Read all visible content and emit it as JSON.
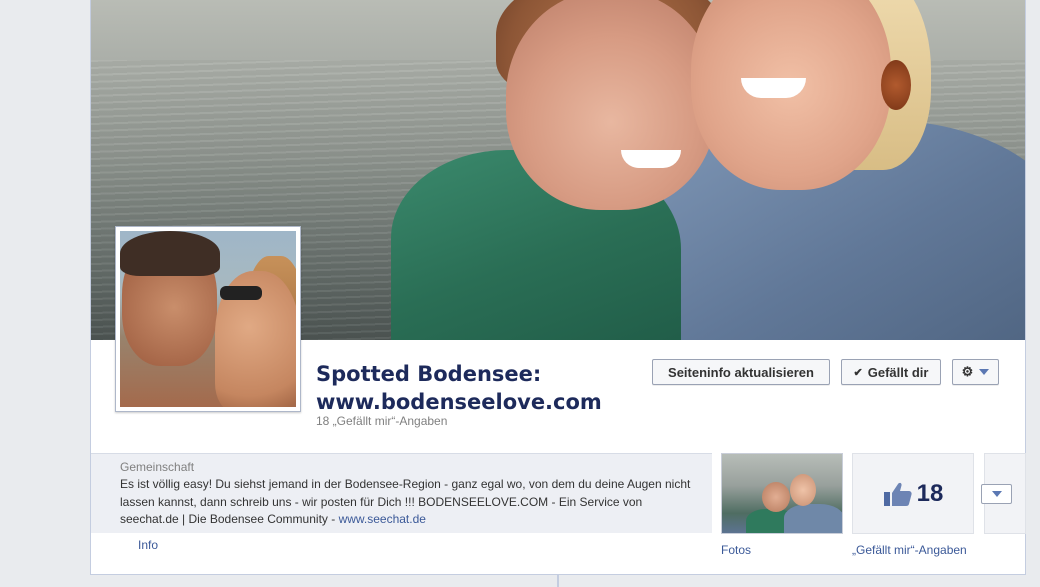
{
  "page": {
    "title_line1": "Spotted Bodensee:",
    "title_line2": "www.bodenseelove.com",
    "likes_line": "18 „Gefällt mir“-Angaben"
  },
  "actions": {
    "update_info_label": "Seiteninfo aktualisieren",
    "liked_label": "Gefällt dir",
    "liked_icon": "checkmark-icon",
    "settings_icon": "gear-icon"
  },
  "about": {
    "category": "Gemeinschaft",
    "description": "Es ist völlig easy! Du siehst jemand in der Bodensee-Region - ganz egal wo, von dem du deine Augen nicht lassen kannst, dann schreib uns - wir posten für Dich !!! BODENSEELOVE.COM - Ein Service von seechat.de | Die Bodensee Community - ",
    "link": "www.seechat.de",
    "info_label": "Info"
  },
  "apps": {
    "photos_label": "Fotos",
    "likes_count": "18",
    "likes_label": "„Gefällt mir“-Angaben",
    "likes_icon": "thumbs-up-icon"
  },
  "colors": {
    "title": "#1d2a5b",
    "link": "#3b5998",
    "background": "#e9ebee"
  }
}
